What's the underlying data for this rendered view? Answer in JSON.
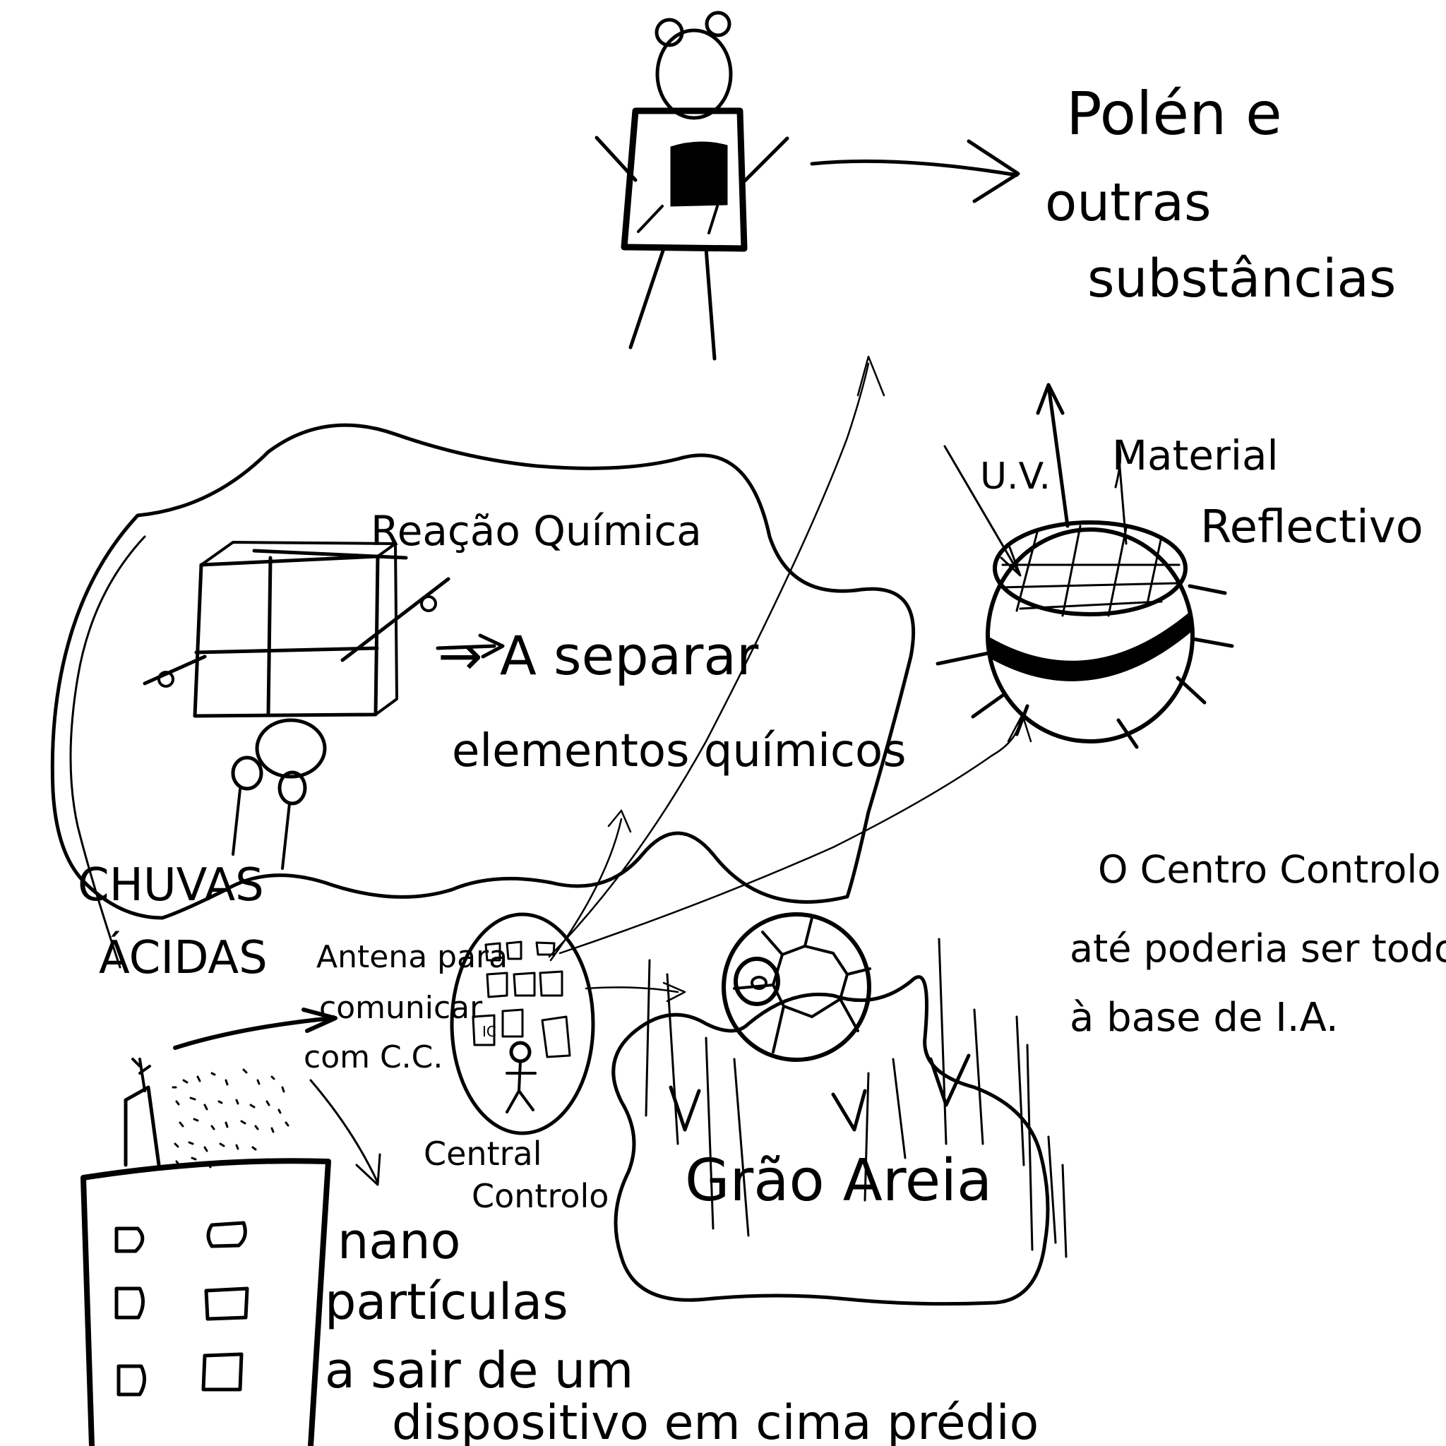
{
  "labels": {
    "polen_line1": "Polén e",
    "polen_line2": "outras",
    "polen_line3": "substâncias",
    "reacao": "Reação Química",
    "separar": "→ A separar",
    "elementos": "elementos químicos",
    "uv": "U.V.",
    "material_line1": "Material",
    "material_line2": "Reflectivo",
    "chuvas_line1": "CHUVAS",
    "chuvas_line2": "ÁCIDAS",
    "centro_line1": "O Centro Controlo",
    "centro_line2": "até poderia ser todo",
    "centro_line3": "à base de I.A.",
    "antena_line1": "Antena para",
    "antena_line2": "comunicar",
    "antena_line3": "com C.C.",
    "central_line1": "Central",
    "central_line2": "Controlo",
    "grao_areia": "Grão Areia",
    "nano_line1": "nano",
    "nano_line2": "partículas",
    "nano_line3": "a sair de um",
    "nano_line4": "dispositivo em cima prédio"
  }
}
